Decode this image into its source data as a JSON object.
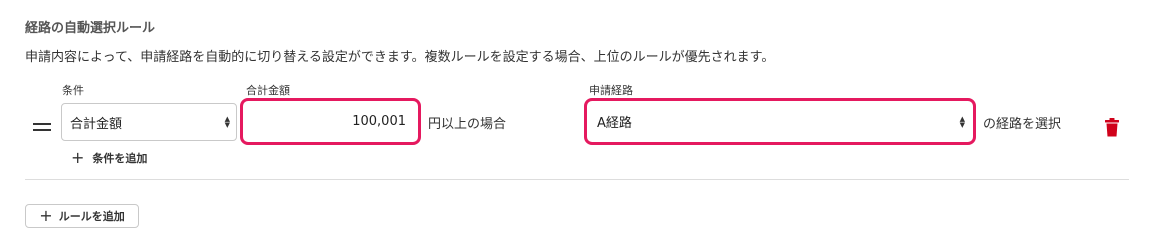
{
  "section": {
    "title": "経路の自動選択ルール",
    "description": "申請内容によって、申請経路を自動的に切り替える設定ができます。複数ルールを設定する場合、上位のルールが優先されます。"
  },
  "rule": {
    "condition_label": "条件",
    "condition_value": "合計金額",
    "amount_label": "合計金額",
    "amount_value": "100,001",
    "amount_suffix": "円以上の場合",
    "route_label": "申請経路",
    "route_value": "A経路",
    "route_suffix": "の経路を選択",
    "add_condition_label": "条件を追加"
  },
  "actions": {
    "add_rule_label": "ルールを追加"
  },
  "icons": {
    "drag": "drag-handle-icon",
    "trash": "trash-icon",
    "plus": "plus-icon",
    "select_arrows": "select-arrows-icon"
  },
  "colors": {
    "highlight": "#e5195f",
    "trash": "#d0021b"
  }
}
